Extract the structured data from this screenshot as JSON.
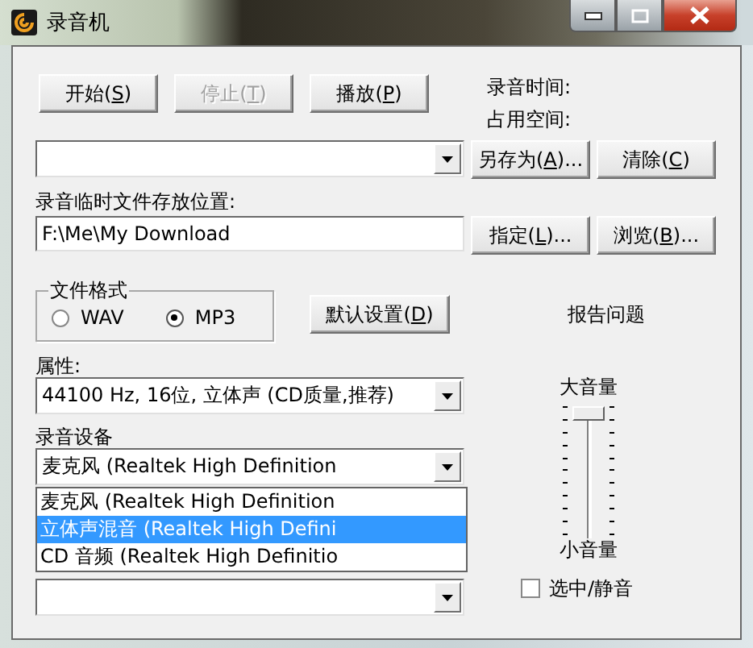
{
  "window": {
    "title": "录音机"
  },
  "transport_buttons": [
    {
      "pre": "开始(",
      "key": "S",
      "post": ")",
      "disabled": false
    },
    {
      "pre": "停止(",
      "key": "T",
      "post": ")",
      "disabled": true
    },
    {
      "pre": "播放(",
      "key": "P",
      "post": ")",
      "disabled": false
    }
  ],
  "status_labels": [
    "录音时间:",
    "占用空间:"
  ],
  "file_buttons": [
    {
      "pre": "另存为(",
      "key": "A",
      "post": ")..."
    },
    {
      "pre": "清除(",
      "key": "C",
      "post": ")"
    }
  ],
  "temp_path": {
    "label": "录音临时文件存放位置:",
    "value": "F:\\Me\\My Download"
  },
  "path_buttons": [
    {
      "pre": "指定(",
      "key": "L",
      "post": ")..."
    },
    {
      "pre": "浏览(",
      "key": "B",
      "post": ")..."
    }
  ],
  "file_format": {
    "title": "文件格式",
    "options": [
      {
        "label": "WAV",
        "selected": false
      },
      {
        "label": "MP3",
        "selected": true
      }
    ]
  },
  "default_button": {
    "pre": "默认设置(",
    "key": "D",
    "post": ")"
  },
  "report_link": "报告问题",
  "properties": {
    "label": "属性:",
    "value": "44100 Hz, 16位, 立体声 (CD质量,推荐)"
  },
  "device": {
    "label": "录音设备",
    "value": "麦克风 (Realtek High Definition",
    "expanded": true,
    "options": [
      {
        "label": "麦克风 (Realtek High Definition",
        "highlighted": false
      },
      {
        "label": "立体声混音 (Realtek High Defini",
        "highlighted": true
      },
      {
        "label": "CD 音频 (Realtek High Definitio",
        "highlighted": false
      }
    ]
  },
  "volume": {
    "max_label": "大音量",
    "level": 1,
    "min_label": "小音量"
  },
  "mute": {
    "label": "选中/静音",
    "checked": false
  }
}
